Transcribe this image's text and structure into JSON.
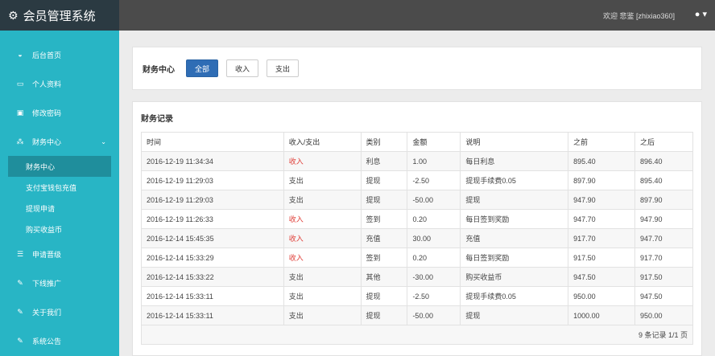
{
  "app": {
    "title": "会员管理系统",
    "welcome": "欢迎 悲鉴 [zhixiao360]"
  },
  "sidebar": {
    "items": [
      {
        "label": "后台首页",
        "icon": "dashboard-icon"
      },
      {
        "label": "个人资料",
        "icon": "monitor-icon"
      },
      {
        "label": "修改密码",
        "icon": "image-icon"
      },
      {
        "label": "财务中心",
        "icon": "sitemap-icon"
      }
    ],
    "subitems": [
      "财务中心",
      "支付宝钱包充值",
      "提现申请",
      "购买收益币"
    ],
    "items2": [
      {
        "label": "申请晋级",
        "icon": "list-icon"
      },
      {
        "label": "下线推广",
        "icon": "edit-icon"
      },
      {
        "label": "关于我们",
        "icon": "edit-icon"
      },
      {
        "label": "系统公告",
        "icon": "edit-icon"
      }
    ]
  },
  "finance": {
    "title": "财务中心",
    "filters": [
      "全部",
      "收入",
      "支出"
    ]
  },
  "records": {
    "title": "财务记录",
    "columns": [
      "时间",
      "收入/支出",
      "类别",
      "金额",
      "说明",
      "之前",
      "之后"
    ],
    "rows": [
      [
        "2016-12-19 11:34:34",
        "收入",
        "利息",
        "1.00",
        "每日利息",
        "895.40",
        "896.40"
      ],
      [
        "2016-12-19 11:29:03",
        "支出",
        "提现",
        "-2.50",
        "提现手续费0.05",
        "897.90",
        "895.40"
      ],
      [
        "2016-12-19 11:29:03",
        "支出",
        "提现",
        "-50.00",
        "提现",
        "947.90",
        "897.90"
      ],
      [
        "2016-12-19 11:26:33",
        "收入",
        "签到",
        "0.20",
        "每日签到奖励",
        "947.70",
        "947.90"
      ],
      [
        "2016-12-14 15:45:35",
        "收入",
        "充值",
        "30.00",
        "充值",
        "917.70",
        "947.70"
      ],
      [
        "2016-12-14 15:33:29",
        "收入",
        "签到",
        "0.20",
        "每日签到奖励",
        "917.50",
        "917.70"
      ],
      [
        "2016-12-14 15:33:22",
        "支出",
        "其他",
        "-30.00",
        "购买收益币",
        "947.50",
        "917.50"
      ],
      [
        "2016-12-14 15:33:11",
        "支出",
        "提现",
        "-2.50",
        "提现手续费0.05",
        "950.00",
        "947.50"
      ],
      [
        "2016-12-14 15:33:11",
        "支出",
        "提现",
        "-50.00",
        "提现",
        "1000.00",
        "950.00"
      ]
    ],
    "pager": "9 条记录 1/1 页"
  },
  "colors": {
    "sidebar": "#28b5c5",
    "topbar": "#4b4b4b",
    "income": "#e0403a",
    "primary": "#2f6db5"
  }
}
